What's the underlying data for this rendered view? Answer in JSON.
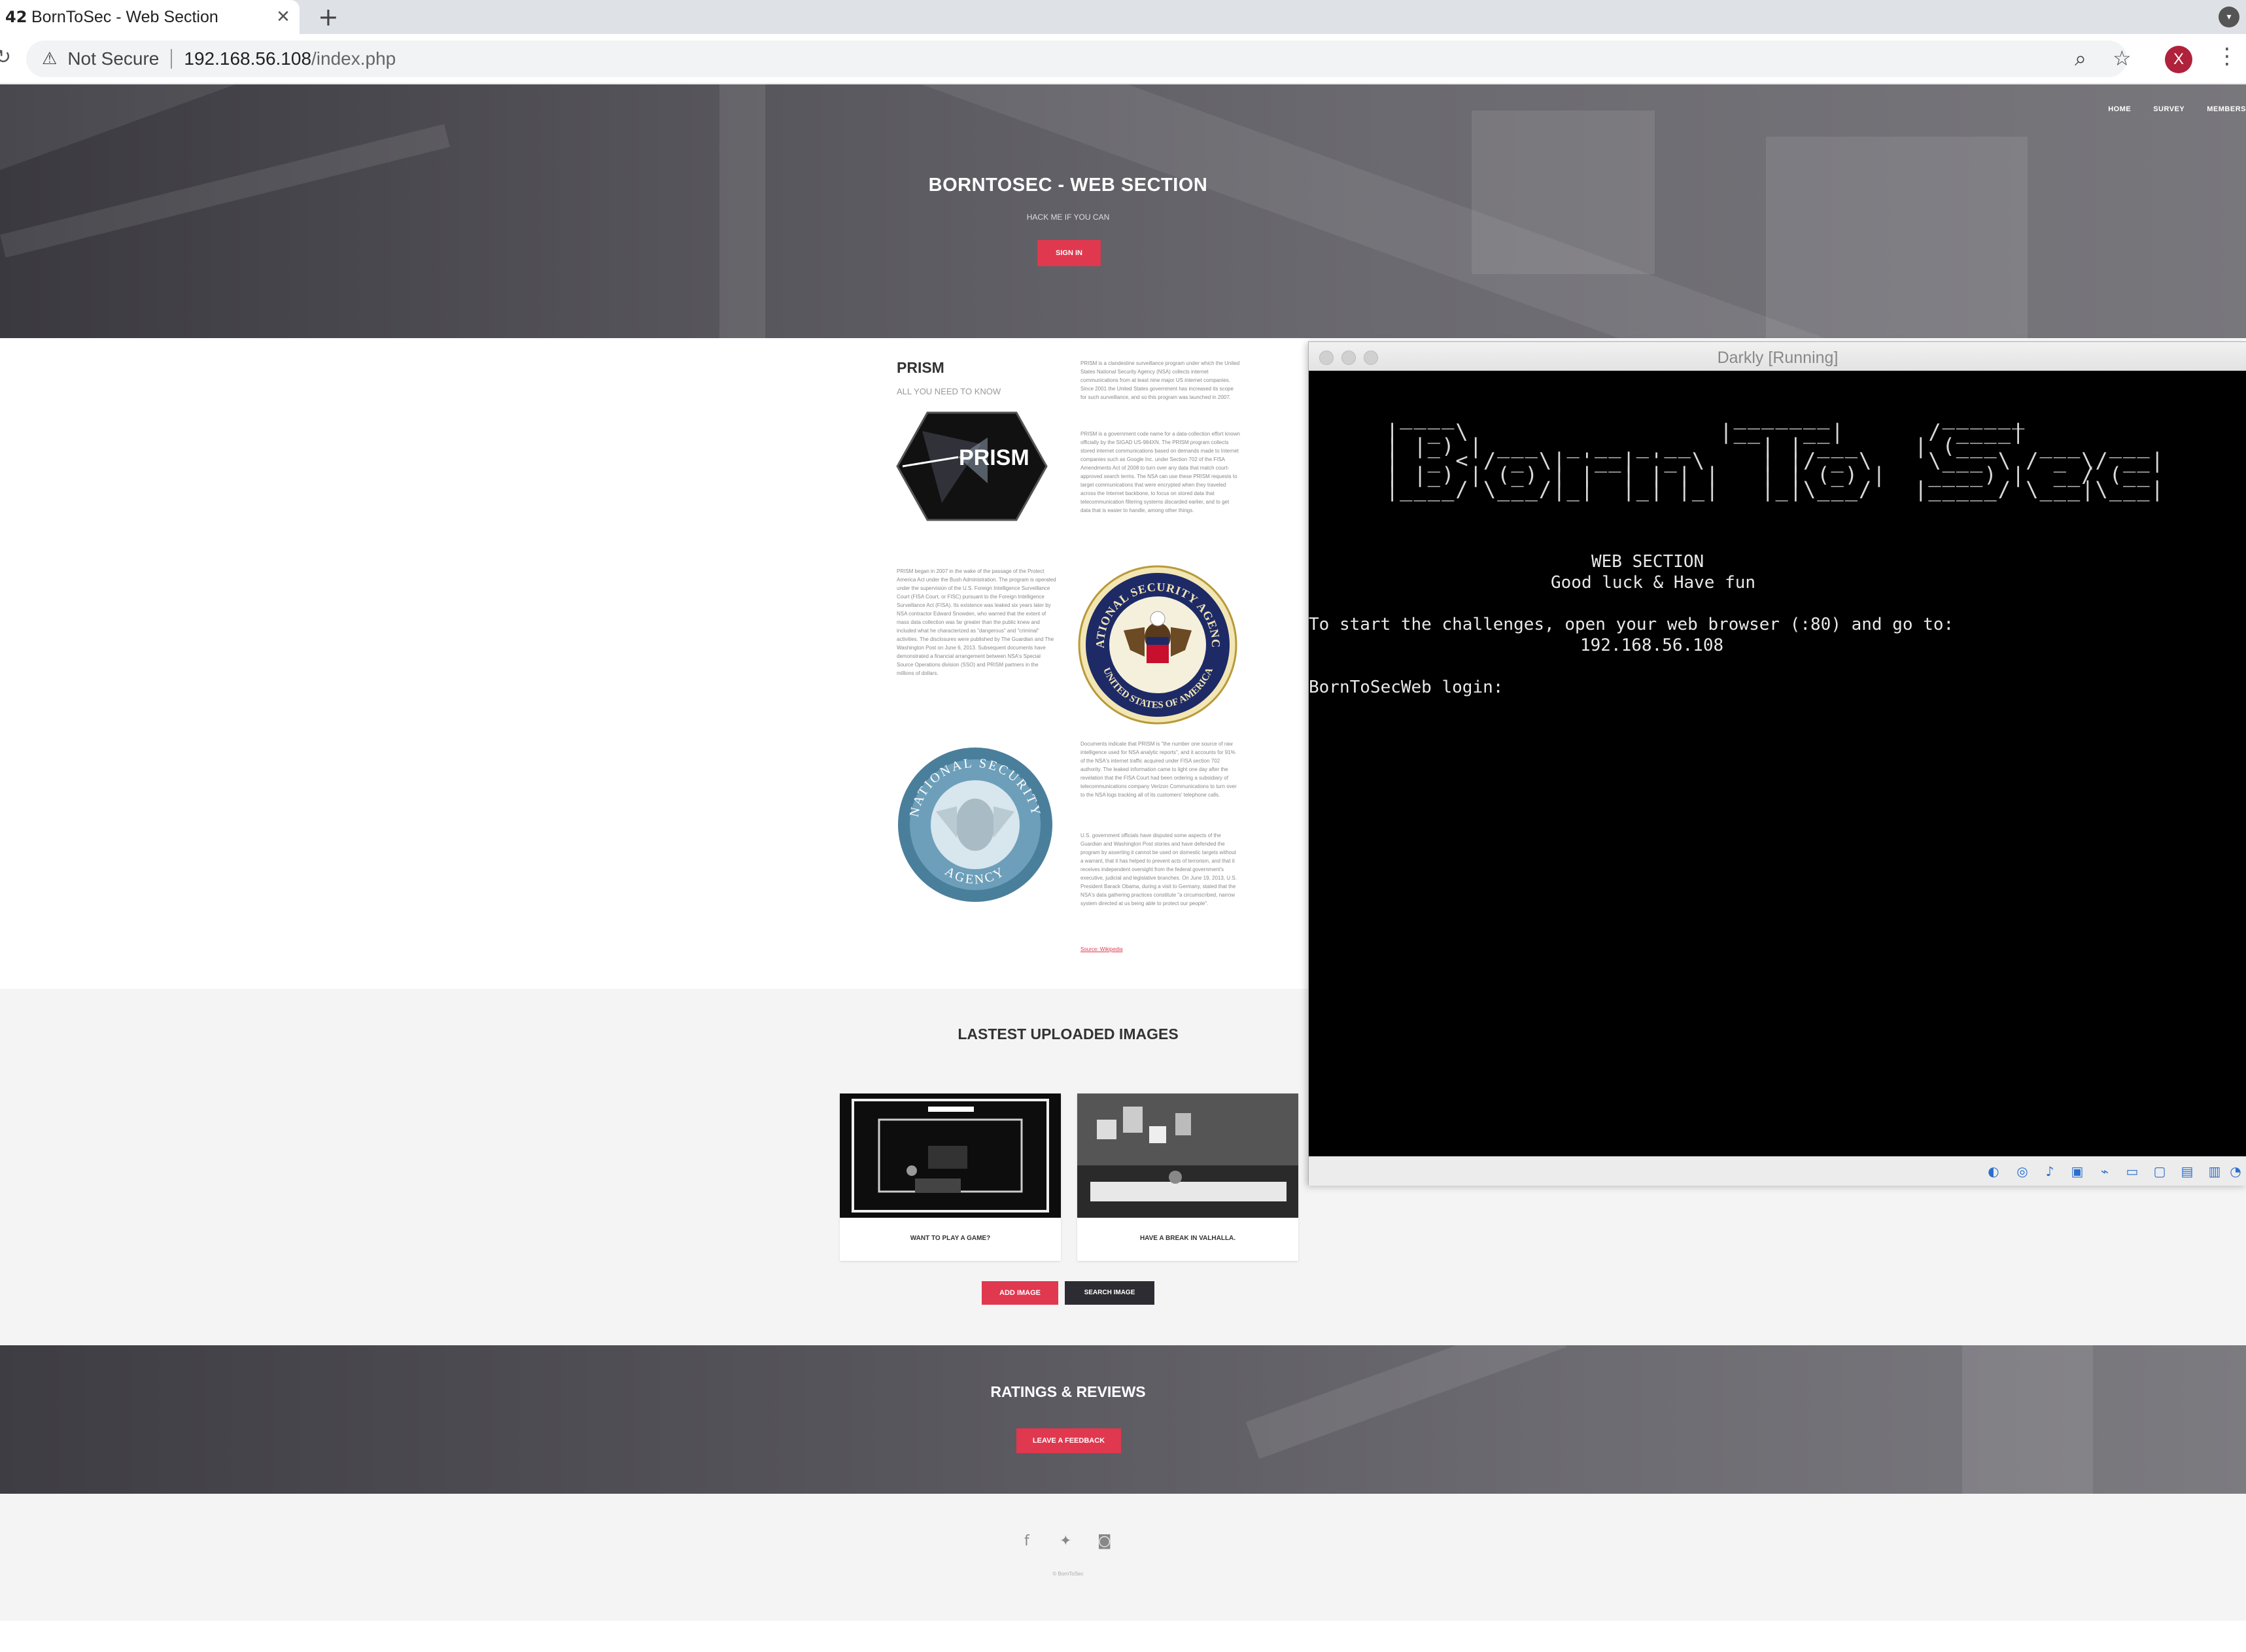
{
  "browser": {
    "tab_title": "BornToSec - Web Section",
    "tab_favicon": "42",
    "tab_close": "✕",
    "new_tab": "+",
    "not_secure": "Not Secure",
    "url_host": "192.168.56.108",
    "url_path": "/index.php",
    "profile_initial": "X"
  },
  "site": {
    "nav": [
      "HOME",
      "SURVEY",
      "MEMBERS"
    ],
    "hero_title": "BORNTOSEC - WEB SECTION",
    "hero_subtitle": "HACK ME IF YOU CAN",
    "signin_label": "SIGN IN",
    "prism": {
      "title": "PRISM",
      "subtitle": "ALL YOU NEED TO KNOW",
      "logo_text": "PRISM",
      "para1": "PRISM is a clandestine surveillance program under which the United States National Security Agency (NSA) collects internet communications from at least nine major US internet companies. Since 2001 the United States government has increased its scope for such surveillance, and so this program was launched in 2007.",
      "para2": "PRISM is a government code name for a data-collection effort known officially by the SIGAD US-984XN. The PRISM program collects stored internet communications based on demands made to Internet companies such as Google Inc. under Section 702 of the FISA Amendments Act of 2008 to turn over any data that match court-approved search terms. The NSA can use these PRISM requests to target communications that were encrypted when they traveled across the Internet backbone, to focus on stored data that telecommunication filtering systems discarded earlier, and to get data that is easier to handle, among other things.",
      "para3": "PRISM began in 2007 in the wake of the passage of the Protect America Act under the Bush Administration. The program is operated under the supervision of the U.S. Foreign Intelligence Surveillance Court (FISA Court, or FISC) pursuant to the Foreign Intelligence Surveillance Act (FISA). Its existence was leaked six years later by NSA contractor Edward Snowden, who warned that the extent of mass data collection was far greater than the public knew and included what he characterized as \"dangerous\" and \"criminal\" activities. The disclosures were published by The Guardian and The Washington Post on June 6, 2013. Subsequent documents have demonstrated a financial arrangement between NSA's Special Source Operations division (SSO) and PRISM partners in the millions of dollars.",
      "para4": "Documents indicate that PRISM is \"the number one source of raw intelligence used for NSA analytic reports\", and it accounts for 91% of the NSA's internet traffic acquired under FISA section 702 authority. The leaked information came to light one day after the revelation that the FISA Court had been ordering a subsidiary of telecommunications company Verizon Communications to turn over to the NSA logs tracking all of its customers' telephone calls.",
      "para5": "U.S. government officials have disputed some aspects of the Guardian and Washington Post stories and have defended the program by asserting it cannot be used on domestic targets without a warrant, that it has helped to prevent acts of terrorism, and that it receives independent oversight from the federal government's executive, judicial and legislative branches. On June 19, 2013, U.S. President Barack Obama, during a visit to Germany, stated that the NSA's data gathering practices constitute \"a circumscribed, narrow system directed at us being able to protect our people\".",
      "source_link": "Source: Wikipedia",
      "seal_text_top": "NATIONAL SECURITY AGENCY",
      "seal_text_bottom": "UNITED STATES OF AMERICA",
      "old_seal_top": "NATIONAL SECURITY",
      "old_seal_bottom": "AGENCY"
    },
    "latest": {
      "title": "LASTEST UPLOADED IMAGES",
      "cards": [
        {
          "caption": "WANT TO PLAY A GAME?"
        },
        {
          "caption": "HAVE A BREAK IN VALHALLA."
        }
      ],
      "add_image_label": "ADD IMAGE",
      "search_image_label": "SEARCH IMAGE"
    },
    "ratings": {
      "title": "RATINGS & REVIEWS",
      "feedback_label": "LEAVE A FEEDBACK"
    },
    "footer": {
      "social_icons": [
        "facebook-icon",
        "twitter-icon",
        "instagram-icon"
      ],
      "copyright": "© BornToSec"
    }
  },
  "vbox": {
    "title": "Darkly [Running]",
    "ascii_art": " ____                    _______        ______\n|  _ \\                  |__   __|      / ____|\n| |_) | ___  _ __ _ __     | | ___    | (___   ___  ___\n|  _ < / _ \\| '__| '_ \\    | |/ _ \\    \\___ \\ / _ \\/ __|\n| |_) | (_) | |  | | | |   | | (_) |   ____) |  __/ (__\n|____/ \\___/|_|  |_| |_|   |_|\\___/   |_____/ \\___|\\___|",
    "line_web_section": "WEB SECTION",
    "line_good_luck": "Good luck & Have fun",
    "line_start": "To start the challenges, open your web browser (:80) and go to:",
    "line_ip": "192.168.56.108",
    "line_login": "BornToSecWeb login:"
  }
}
